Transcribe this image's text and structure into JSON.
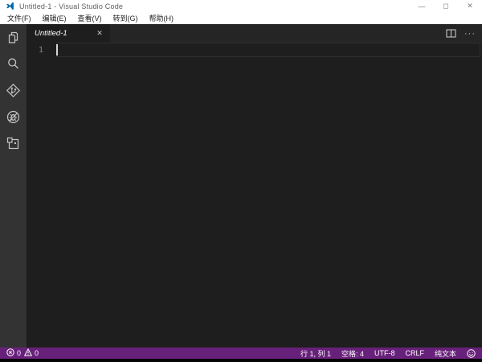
{
  "window": {
    "title": "Untitled-1 - Visual Studio Code",
    "controls": {
      "minimize": "—",
      "maximize": "◻",
      "close": "✕"
    }
  },
  "menu": {
    "items": [
      {
        "label": "文件(F)"
      },
      {
        "label": "编辑(E)"
      },
      {
        "label": "查看(V)"
      },
      {
        "label": "转到(G)"
      },
      {
        "label": "帮助(H)"
      }
    ]
  },
  "activity_bar": {
    "items": [
      {
        "name": "explorer"
      },
      {
        "name": "search"
      },
      {
        "name": "source-control"
      },
      {
        "name": "debug"
      },
      {
        "name": "extensions"
      }
    ]
  },
  "tabs": [
    {
      "label": "Untitled-1",
      "close_glyph": "✕"
    }
  ],
  "editor": {
    "line_numbers": [
      "1"
    ]
  },
  "tab_actions": {
    "more_glyph": "···"
  },
  "status_bar": {
    "errors": "0",
    "warnings": "0",
    "cursor_position": "行 1, 列 1",
    "indentation": "空格: 4",
    "encoding": "UTF-8",
    "eol": "CRLF",
    "language_mode": "纯文本"
  },
  "colors": {
    "statusbar": "#68217a",
    "activitybar": "#333333",
    "editor_bg": "#1e1e1e",
    "tabbar_bg": "#252526",
    "titlebar_bg": "#ffffff",
    "logo_blue": "#0065a9",
    "icon_gray": "#c5c5c5",
    "line_number": "#858585"
  }
}
